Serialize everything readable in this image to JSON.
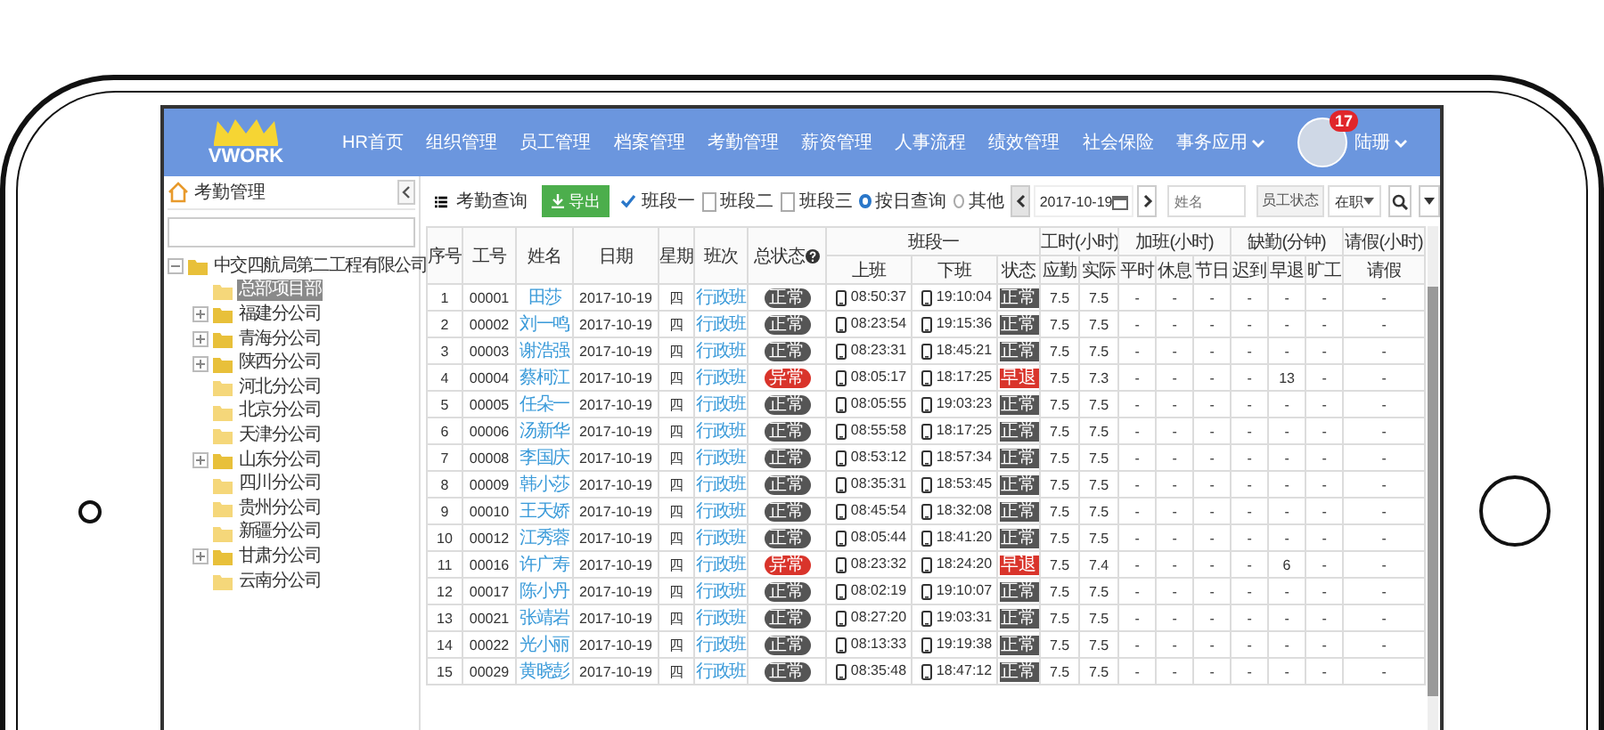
{
  "header": {
    "logo": "VWORK",
    "nav": [
      {
        "label": "HR首页",
        "dropdown": false
      },
      {
        "label": "组织管理",
        "dropdown": false
      },
      {
        "label": "员工管理",
        "dropdown": false
      },
      {
        "label": "档案管理",
        "dropdown": false
      },
      {
        "label": "考勤管理",
        "dropdown": false
      },
      {
        "label": "薪资管理",
        "dropdown": false
      },
      {
        "label": "人事流程",
        "dropdown": false
      },
      {
        "label": "绩效管理",
        "dropdown": false
      },
      {
        "label": "社会保险",
        "dropdown": false
      },
      {
        "label": "事务应用",
        "dropdown": true
      }
    ],
    "user": {
      "name": "陆珊",
      "badge": "17"
    }
  },
  "sidebar": {
    "title": "考勤管理",
    "tree": [
      {
        "label": "中交四航局第二工程有限公司",
        "expanded": true,
        "children": [
          {
            "label": "总部项目部",
            "selected": true,
            "expandable": false
          },
          {
            "label": "福建分公司",
            "selected": false,
            "expandable": true
          },
          {
            "label": "青海分公司",
            "selected": false,
            "expandable": true
          },
          {
            "label": "陕西分公司",
            "selected": false,
            "expandable": true
          },
          {
            "label": "河北分公司",
            "selected": false,
            "expandable": false
          },
          {
            "label": "北京分公司",
            "selected": false,
            "expandable": false
          },
          {
            "label": "天津分公司",
            "selected": false,
            "expandable": false
          },
          {
            "label": "山东分公司",
            "selected": false,
            "expandable": true
          },
          {
            "label": "四川分公司",
            "selected": false,
            "expandable": false
          },
          {
            "label": "贵州分公司",
            "selected": false,
            "expandable": false
          },
          {
            "label": "新疆分公司",
            "selected": false,
            "expandable": false
          },
          {
            "label": "甘肃分公司",
            "selected": false,
            "expandable": true
          },
          {
            "label": "云南分公司",
            "selected": false,
            "expandable": false
          }
        ]
      }
    ]
  },
  "toolbar": {
    "title": "考勤查询",
    "export": "导出",
    "segments": [
      {
        "label": "班段一",
        "checked": true
      },
      {
        "label": "班段二",
        "checked": false
      },
      {
        "label": "班段三",
        "checked": false
      }
    ],
    "modes": [
      {
        "label": "按日查询",
        "selected": true
      },
      {
        "label": "其他",
        "selected": false
      }
    ],
    "date": "2017-10-19",
    "name_search": {
      "placeholder": "姓名"
    },
    "status_label": "员工状态",
    "status_select": "在职"
  },
  "table": {
    "columns": [
      {
        "label": "序号"
      },
      {
        "label": "工号"
      },
      {
        "label": "姓名"
      },
      {
        "label": "日期"
      },
      {
        "label": "星期"
      },
      {
        "label": "班次"
      },
      {
        "label": "总状态",
        "help": true
      },
      {
        "label": "班段一",
        "children": [
          {
            "label": "上班"
          },
          {
            "label": "下班"
          },
          {
            "label": "状态"
          }
        ]
      },
      {
        "label": "工时(小时)",
        "children": [
          {
            "label": "应勤"
          },
          {
            "label": "实际"
          }
        ]
      },
      {
        "label": "加班(小时)",
        "children": [
          {
            "label": "平时"
          },
          {
            "label": "休息"
          },
          {
            "label": "节日"
          }
        ]
      },
      {
        "label": "缺勤(分钟)",
        "children": [
          {
            "label": "迟到"
          },
          {
            "label": "早退"
          },
          {
            "label": "旷工"
          }
        ]
      },
      {
        "label": "请假(小时)",
        "children": [
          {
            "label": "请假"
          }
        ]
      }
    ],
    "rows": [
      {
        "no": "1",
        "id": "00001",
        "name": "田莎",
        "date": "2017-10-19",
        "weekday": "四",
        "shift": "行政班",
        "status": {
          "label": "正常",
          "kind": "normal"
        },
        "in": "08:50:37",
        "out": "19:10:04",
        "seg_status": {
          "label": "正常",
          "kind": "normal"
        },
        "required": "7.5",
        "actual": "7.5",
        "stats": [
          "-",
          "-",
          "-",
          "-",
          "-",
          "-",
          "-"
        ]
      },
      {
        "no": "2",
        "id": "00002",
        "name": "刘一鸣",
        "date": "2017-10-19",
        "weekday": "四",
        "shift": "行政班",
        "status": {
          "label": "正常",
          "kind": "normal"
        },
        "in": "08:23:54",
        "out": "19:15:36",
        "seg_status": {
          "label": "正常",
          "kind": "normal"
        },
        "required": "7.5",
        "actual": "7.5",
        "stats": [
          "-",
          "-",
          "-",
          "-",
          "-",
          "-",
          "-"
        ]
      },
      {
        "no": "3",
        "id": "00003",
        "name": "谢浩强",
        "date": "2017-10-19",
        "weekday": "四",
        "shift": "行政班",
        "status": {
          "label": "正常",
          "kind": "normal"
        },
        "in": "08:23:31",
        "out": "18:45:21",
        "seg_status": {
          "label": "正常",
          "kind": "normal"
        },
        "required": "7.5",
        "actual": "7.5",
        "stats": [
          "-",
          "-",
          "-",
          "-",
          "-",
          "-",
          "-"
        ]
      },
      {
        "no": "4",
        "id": "00004",
        "name": "蔡柯江",
        "date": "2017-10-19",
        "weekday": "四",
        "shift": "行政班",
        "status": {
          "label": "异常",
          "kind": "abnormal"
        },
        "in": "08:05:17",
        "out": "18:17:25",
        "seg_status": {
          "label": "早退",
          "kind": "abnormal"
        },
        "required": "7.5",
        "actual": "7.3",
        "stats": [
          "-",
          "-",
          "-",
          "-",
          "13",
          "-",
          "-"
        ]
      },
      {
        "no": "5",
        "id": "00005",
        "name": "任朵一",
        "date": "2017-10-19",
        "weekday": "四",
        "shift": "行政班",
        "status": {
          "label": "正常",
          "kind": "normal"
        },
        "in": "08:05:55",
        "out": "19:03:23",
        "seg_status": {
          "label": "正常",
          "kind": "normal"
        },
        "required": "7.5",
        "actual": "7.5",
        "stats": [
          "-",
          "-",
          "-",
          "-",
          "-",
          "-",
          "-"
        ]
      },
      {
        "no": "6",
        "id": "00006",
        "name": "汤新华",
        "date": "2017-10-19",
        "weekday": "四",
        "shift": "行政班",
        "status": {
          "label": "正常",
          "kind": "normal"
        },
        "in": "08:55:58",
        "out": "18:17:25",
        "seg_status": {
          "label": "正常",
          "kind": "normal"
        },
        "required": "7.5",
        "actual": "7.5",
        "stats": [
          "-",
          "-",
          "-",
          "-",
          "-",
          "-",
          "-"
        ]
      },
      {
        "no": "7",
        "id": "00008",
        "name": "李国庆",
        "date": "2017-10-19",
        "weekday": "四",
        "shift": "行政班",
        "status": {
          "label": "正常",
          "kind": "normal"
        },
        "in": "08:53:12",
        "out": "18:57:34",
        "seg_status": {
          "label": "正常",
          "kind": "normal"
        },
        "required": "7.5",
        "actual": "7.5",
        "stats": [
          "-",
          "-",
          "-",
          "-",
          "-",
          "-",
          "-"
        ]
      },
      {
        "no": "8",
        "id": "00009",
        "name": "韩小莎",
        "date": "2017-10-19",
        "weekday": "四",
        "shift": "行政班",
        "status": {
          "label": "正常",
          "kind": "normal"
        },
        "in": "08:35:31",
        "out": "18:53:45",
        "seg_status": {
          "label": "正常",
          "kind": "normal"
        },
        "required": "7.5",
        "actual": "7.5",
        "stats": [
          "-",
          "-",
          "-",
          "-",
          "-",
          "-",
          "-"
        ]
      },
      {
        "no": "9",
        "id": "00010",
        "name": "王天娇",
        "date": "2017-10-19",
        "weekday": "四",
        "shift": "行政班",
        "status": {
          "label": "正常",
          "kind": "normal"
        },
        "in": "08:45:54",
        "out": "18:32:08",
        "seg_status": {
          "label": "正常",
          "kind": "normal"
        },
        "required": "7.5",
        "actual": "7.5",
        "stats": [
          "-",
          "-",
          "-",
          "-",
          "-",
          "-",
          "-"
        ]
      },
      {
        "no": "10",
        "id": "00012",
        "name": "江秀蓉",
        "date": "2017-10-19",
        "weekday": "四",
        "shift": "行政班",
        "status": {
          "label": "正常",
          "kind": "normal"
        },
        "in": "08:05:44",
        "out": "18:41:20",
        "seg_status": {
          "label": "正常",
          "kind": "normal"
        },
        "required": "7.5",
        "actual": "7.5",
        "stats": [
          "-",
          "-",
          "-",
          "-",
          "-",
          "-",
          "-"
        ]
      },
      {
        "no": "11",
        "id": "00016",
        "name": "许广寿",
        "date": "2017-10-19",
        "weekday": "四",
        "shift": "行政班",
        "status": {
          "label": "异常",
          "kind": "abnormal"
        },
        "in": "08:23:32",
        "out": "18:24:20",
        "seg_status": {
          "label": "早退",
          "kind": "abnormal"
        },
        "required": "7.5",
        "actual": "7.4",
        "stats": [
          "-",
          "-",
          "-",
          "-",
          "6",
          "-",
          "-"
        ]
      },
      {
        "no": "12",
        "id": "00017",
        "name": "陈小丹",
        "date": "2017-10-19",
        "weekday": "四",
        "shift": "行政班",
        "status": {
          "label": "正常",
          "kind": "normal"
        },
        "in": "08:02:19",
        "out": "19:10:07",
        "seg_status": {
          "label": "正常",
          "kind": "normal"
        },
        "required": "7.5",
        "actual": "7.5",
        "stats": [
          "-",
          "-",
          "-",
          "-",
          "-",
          "-",
          "-"
        ]
      },
      {
        "no": "13",
        "id": "00021",
        "name": "张靖岩",
        "date": "2017-10-19",
        "weekday": "四",
        "shift": "行政班",
        "status": {
          "label": "正常",
          "kind": "normal"
        },
        "in": "08:27:20",
        "out": "19:03:31",
        "seg_status": {
          "label": "正常",
          "kind": "normal"
        },
        "required": "7.5",
        "actual": "7.5",
        "stats": [
          "-",
          "-",
          "-",
          "-",
          "-",
          "-",
          "-"
        ]
      },
      {
        "no": "14",
        "id": "00022",
        "name": "光小丽",
        "date": "2017-10-19",
        "weekday": "四",
        "shift": "行政班",
        "status": {
          "label": "正常",
          "kind": "normal"
        },
        "in": "08:13:33",
        "out": "19:19:38",
        "seg_status": {
          "label": "正常",
          "kind": "normal"
        },
        "required": "7.5",
        "actual": "7.5",
        "stats": [
          "-",
          "-",
          "-",
          "-",
          "-",
          "-",
          "-"
        ]
      },
      {
        "no": "15",
        "id": "00029",
        "name": "黄晓彭",
        "date": "2017-10-19",
        "weekday": "四",
        "shift": "行政班",
        "status": {
          "label": "正常",
          "kind": "normal"
        },
        "in": "08:35:48",
        "out": "18:47:12",
        "seg_status": {
          "label": "正常",
          "kind": "normal"
        },
        "required": "7.5",
        "actual": "7.5",
        "stats": [
          "-",
          "-",
          "-",
          "-",
          "-",
          "-",
          "-"
        ]
      }
    ]
  }
}
